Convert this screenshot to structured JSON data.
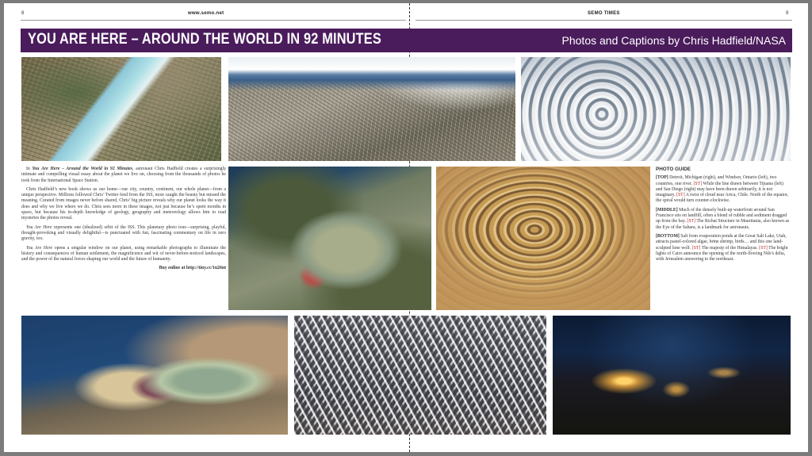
{
  "header": {
    "left_page_number": "8",
    "left_site": "www.semo.net",
    "right_running_head": "SEMO TIMES",
    "right_page_number": "9"
  },
  "banner": {
    "title": "YOU ARE HERE – AROUND THE WORLD IN 92 MINUTES",
    "credit": "Photos and Captions by Chris Hadfield/NASA"
  },
  "essay": {
    "p1_lead": "In ",
    "p1_book": "You Are Here – Around the World in 92 Minutes",
    "p1_rest": ", astronaut Chris Hadfield creates a surprisingly intimate and compelling visual essay about the planet we live on, choosing from the thousands of photos he took from the International Space Station.",
    "p2": "Chris Hadfield’s new book shows us our home—our city, country, continent, our whole planet—from a unique perspective. Millions followed Chris’ Twitter feed from the ISS, most caught the beauty but missed the meaning. Curated from images never before shared, Chris’ big picture reveals why our planet looks the way it does and why we live where we do. Chris sees more in these images, not just because he’s spent months in space, but because his in-depth knowledge of geology, geography and meteorology allows him to read mysteries the photos reveal.",
    "p3_book": "You Are Here",
    "p3_rest": " represents one (idealized) orbit of the ISS. This planetary photo tour—surprising, playful, thought-provoking and visually delightful—is punctuated with fun, fascinating commentary on life in zero gravity, too.",
    "p4_book": "You Are Here",
    "p4_rest": " opens a singular window on our planet, using remarkable photographs to illuminate the history and consequences of human settlement, the magnificence and wit of never-before-noticed landscapes, and the power of the natural forces shaping our world and the future of humanity.",
    "buy_online": "Buy online at http://tiny.cc/1u26nt"
  },
  "photo_guide": {
    "heading": "PHOTO GUIDE",
    "st": "[ST]",
    "top_label": "[TOP]",
    "top_a": " Detroit, Michigan (right), and Windsor, Ontario (left), two countries, one river. ",
    "top_b": " While the line drawn between Tijuana (left) and San Diego (right) may have been drawn arbitrarily, it is not imaginary. ",
    "top_c": " A twist of cloud near Arica, Chile. North of the equator, the spiral would turn counter-clockwise.",
    "middle_label": "[MIDDLE]",
    "middle_a": " Much of the densely built-up waterfront around San Francisco sits on landfill, often a blend of rubble and sediment dragged up from the bay. ",
    "middle_b": " The Richat Structure in Mauritania, also known as the Eye of the Sahara, is a landmark for astronauts.",
    "bottom_label": "[BOTTOM]",
    "bottom_a": " Salt from evaporation ponds at the Great Salt Lake, Utah, attracts pastel-colored algae, brine shrimp, birds… and this one land-sculpted lone wolf. ",
    "bottom_b": " The majesty of the Himalayas. ",
    "bottom_c": " The bright lights of Cairo announce the opening of the north-flowing Nile's delta, with Jerusalem answering to the northeast."
  },
  "colors": {
    "banner": "#4a1c5c",
    "caption_tag": "#b42424"
  }
}
